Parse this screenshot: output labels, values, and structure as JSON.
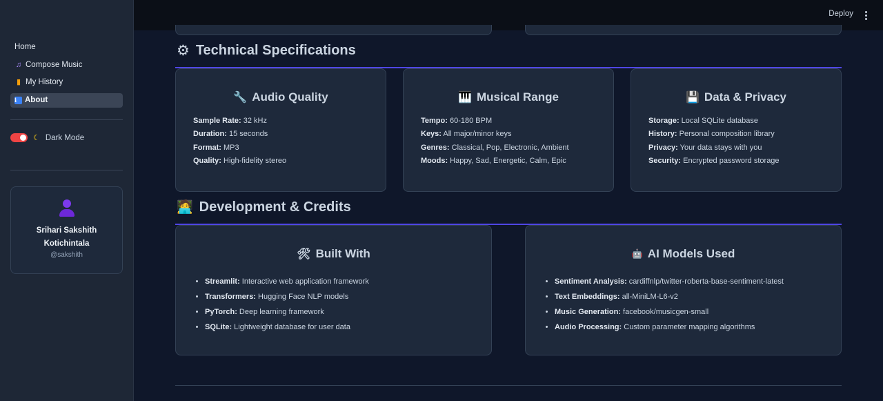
{
  "sidebar": {
    "nav": [
      {
        "label": "Home",
        "icon": ""
      },
      {
        "label": "Compose Music",
        "icon": "♫"
      },
      {
        "label": "My History",
        "icon": "▮"
      },
      {
        "label": "About",
        "icon": "i"
      }
    ],
    "dark_mode_label": "Dark Mode",
    "profile": {
      "name": "Srihari Sakshith Kotichintala",
      "handle": "@sakshith"
    }
  },
  "topbar": {
    "deploy_label": "Deploy"
  },
  "technical": {
    "title": "Technical Specifications",
    "icon": "⚙",
    "cards": [
      {
        "icon": "🔧",
        "title": "Audio Quality",
        "rows": [
          {
            "k": "Sample Rate:",
            "v": " 32 kHz"
          },
          {
            "k": "Duration:",
            "v": " 15 seconds"
          },
          {
            "k": "Format:",
            "v": " MP3"
          },
          {
            "k": "Quality:",
            "v": " High-fidelity stereo"
          }
        ]
      },
      {
        "icon": "🎹",
        "title": "Musical Range",
        "rows": [
          {
            "k": "Tempo:",
            "v": " 60-180 BPM"
          },
          {
            "k": "Keys:",
            "v": " All major/minor keys"
          },
          {
            "k": "Genres:",
            "v": " Classical, Pop, Electronic, Ambient"
          },
          {
            "k": "Moods:",
            "v": " Happy, Sad, Energetic, Calm, Epic"
          }
        ]
      },
      {
        "icon": "💾",
        "title": "Data & Privacy",
        "rows": [
          {
            "k": "Storage:",
            "v": " Local SQLite database"
          },
          {
            "k": "History:",
            "v": " Personal composition library"
          },
          {
            "k": "Privacy:",
            "v": " Your data stays with you"
          },
          {
            "k": "Security:",
            "v": " Encrypted password storage"
          }
        ]
      }
    ]
  },
  "development": {
    "title": "Development & Credits",
    "icon": "🧑‍💻",
    "cards": [
      {
        "icon": "🛠",
        "title": "Built With",
        "items": [
          {
            "k": "Streamlit:",
            "v": " Interactive web application framework"
          },
          {
            "k": "Transformers:",
            "v": " Hugging Face NLP models"
          },
          {
            "k": "PyTorch:",
            "v": " Deep learning framework"
          },
          {
            "k": "SQLite:",
            "v": " Lightweight database for user data"
          }
        ]
      },
      {
        "icon": "🤖",
        "title": "AI Models Used",
        "items": [
          {
            "k": "Sentiment Analysis:",
            "v": " cardiffnlp/twitter-roberta-base-sentiment-latest"
          },
          {
            "k": "Text Embeddings:",
            "v": " all-MiniLM-L6-v2"
          },
          {
            "k": "Music Generation:",
            "v": " facebook/musicgen-small"
          },
          {
            "k": "Audio Processing:",
            "v": " Custom parameter mapping algorithms"
          }
        ]
      }
    ]
  }
}
